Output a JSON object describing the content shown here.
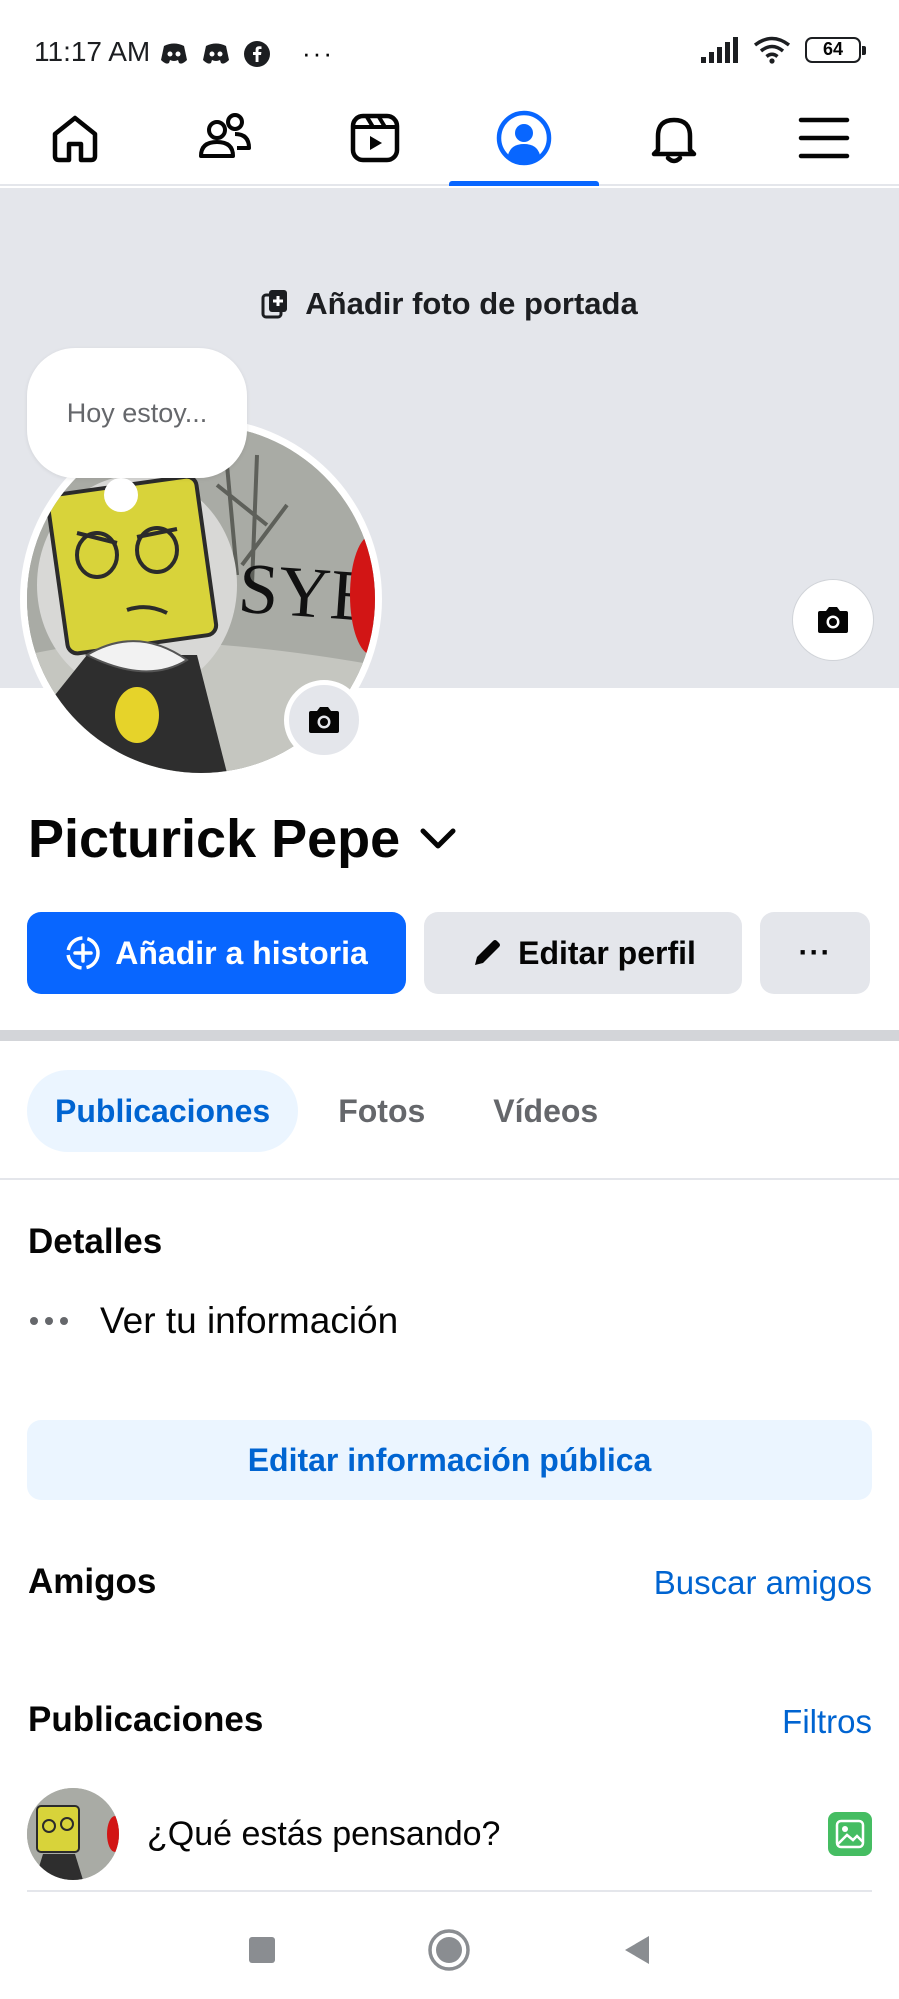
{
  "status_bar": {
    "time": "11:17 AM",
    "more": "···",
    "battery": "64",
    "icons": [
      "discord-icon",
      "discord-icon",
      "facebook-icon",
      "signal-icon",
      "wifi-icon",
      "battery-icon"
    ]
  },
  "nav": {
    "tabs": [
      {
        "name": "home",
        "icon": "home-icon",
        "active": false
      },
      {
        "name": "friends",
        "icon": "friends-icon",
        "active": false
      },
      {
        "name": "video",
        "icon": "video-icon",
        "active": false
      },
      {
        "name": "profile",
        "icon": "profile-icon",
        "active": true
      },
      {
        "name": "notifications",
        "icon": "bell-icon",
        "active": false
      },
      {
        "name": "menu",
        "icon": "hamburger-icon",
        "active": false
      }
    ],
    "accent": "#0866ff"
  },
  "cover": {
    "add_label": "Añadir foto de portada"
  },
  "avatar": {
    "thought_placeholder": "Hoy estoy...",
    "image_text": "SYBAU"
  },
  "profile": {
    "name": "Picturick Pepe"
  },
  "actions": {
    "add_story": "Añadir a historia",
    "edit_profile": "Editar perfil",
    "more": "···"
  },
  "tabs": [
    {
      "label": "Publicaciones",
      "active": true
    },
    {
      "label": "Fotos",
      "active": false
    },
    {
      "label": "Vídeos",
      "active": false
    }
  ],
  "details": {
    "title": "Detalles",
    "see_info": "Ver tu información",
    "edit_public": "Editar información pública"
  },
  "friends": {
    "title": "Amigos",
    "find": "Buscar amigos"
  },
  "posts": {
    "title": "Publicaciones",
    "filters": "Filtros",
    "composer_placeholder": "¿Qué estás pensando?"
  }
}
